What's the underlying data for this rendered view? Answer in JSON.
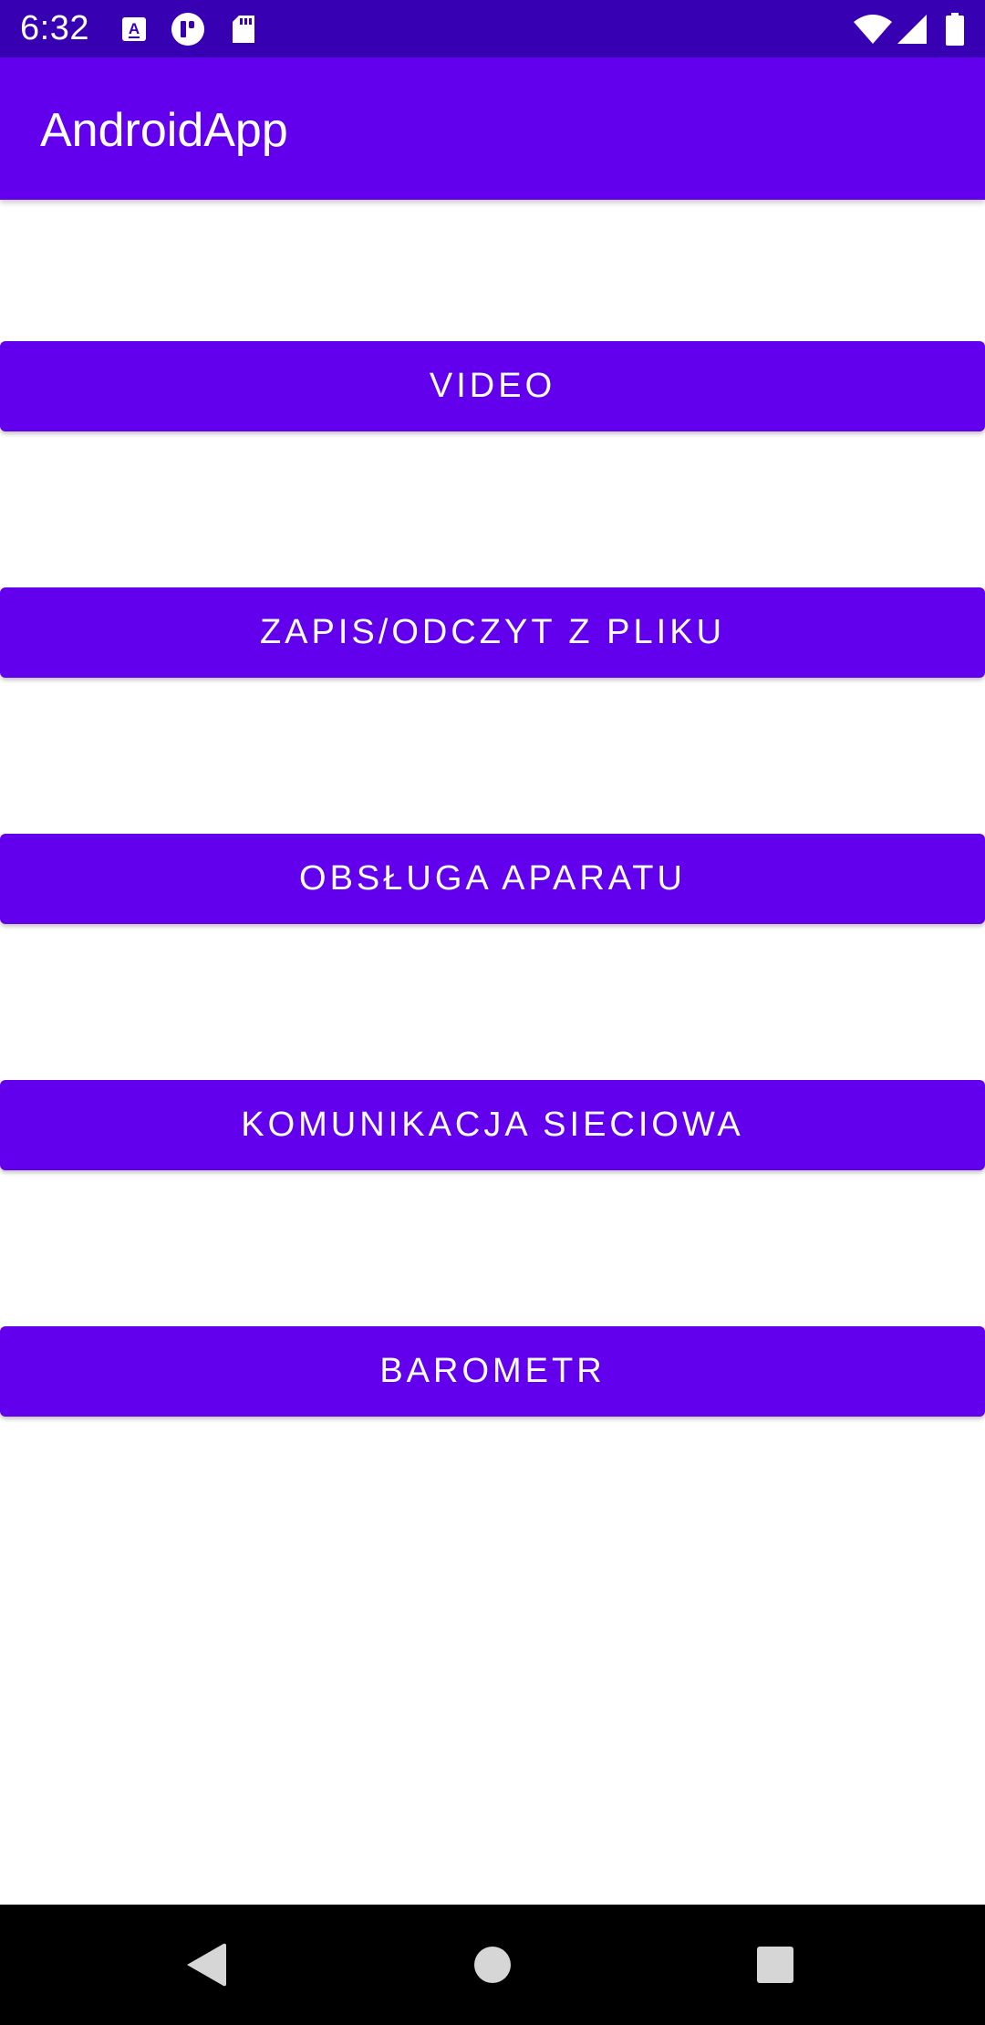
{
  "status_bar": {
    "time": "6:32",
    "left_icons": [
      "keyboard-a-icon",
      "app-notification-icon",
      "sd-card-icon"
    ],
    "right_icons": [
      "wifi-icon",
      "signal-icon",
      "battery-icon"
    ],
    "background": "#3700B3"
  },
  "app_bar": {
    "title": "AndroidApp",
    "background": "#6200EE"
  },
  "buttons": [
    {
      "label": "VIDEO"
    },
    {
      "label": "ZAPIS/ODCZYT Z PLIKU"
    },
    {
      "label": "OBSŁUGA APARATU"
    },
    {
      "label": "KOMUNIKACJA SIECIOWA"
    },
    {
      "label": "BAROMETR"
    }
  ],
  "button_color": "#6200EE",
  "nav_bar": {
    "icons": [
      "back-icon",
      "home-icon",
      "recents-icon"
    ]
  }
}
